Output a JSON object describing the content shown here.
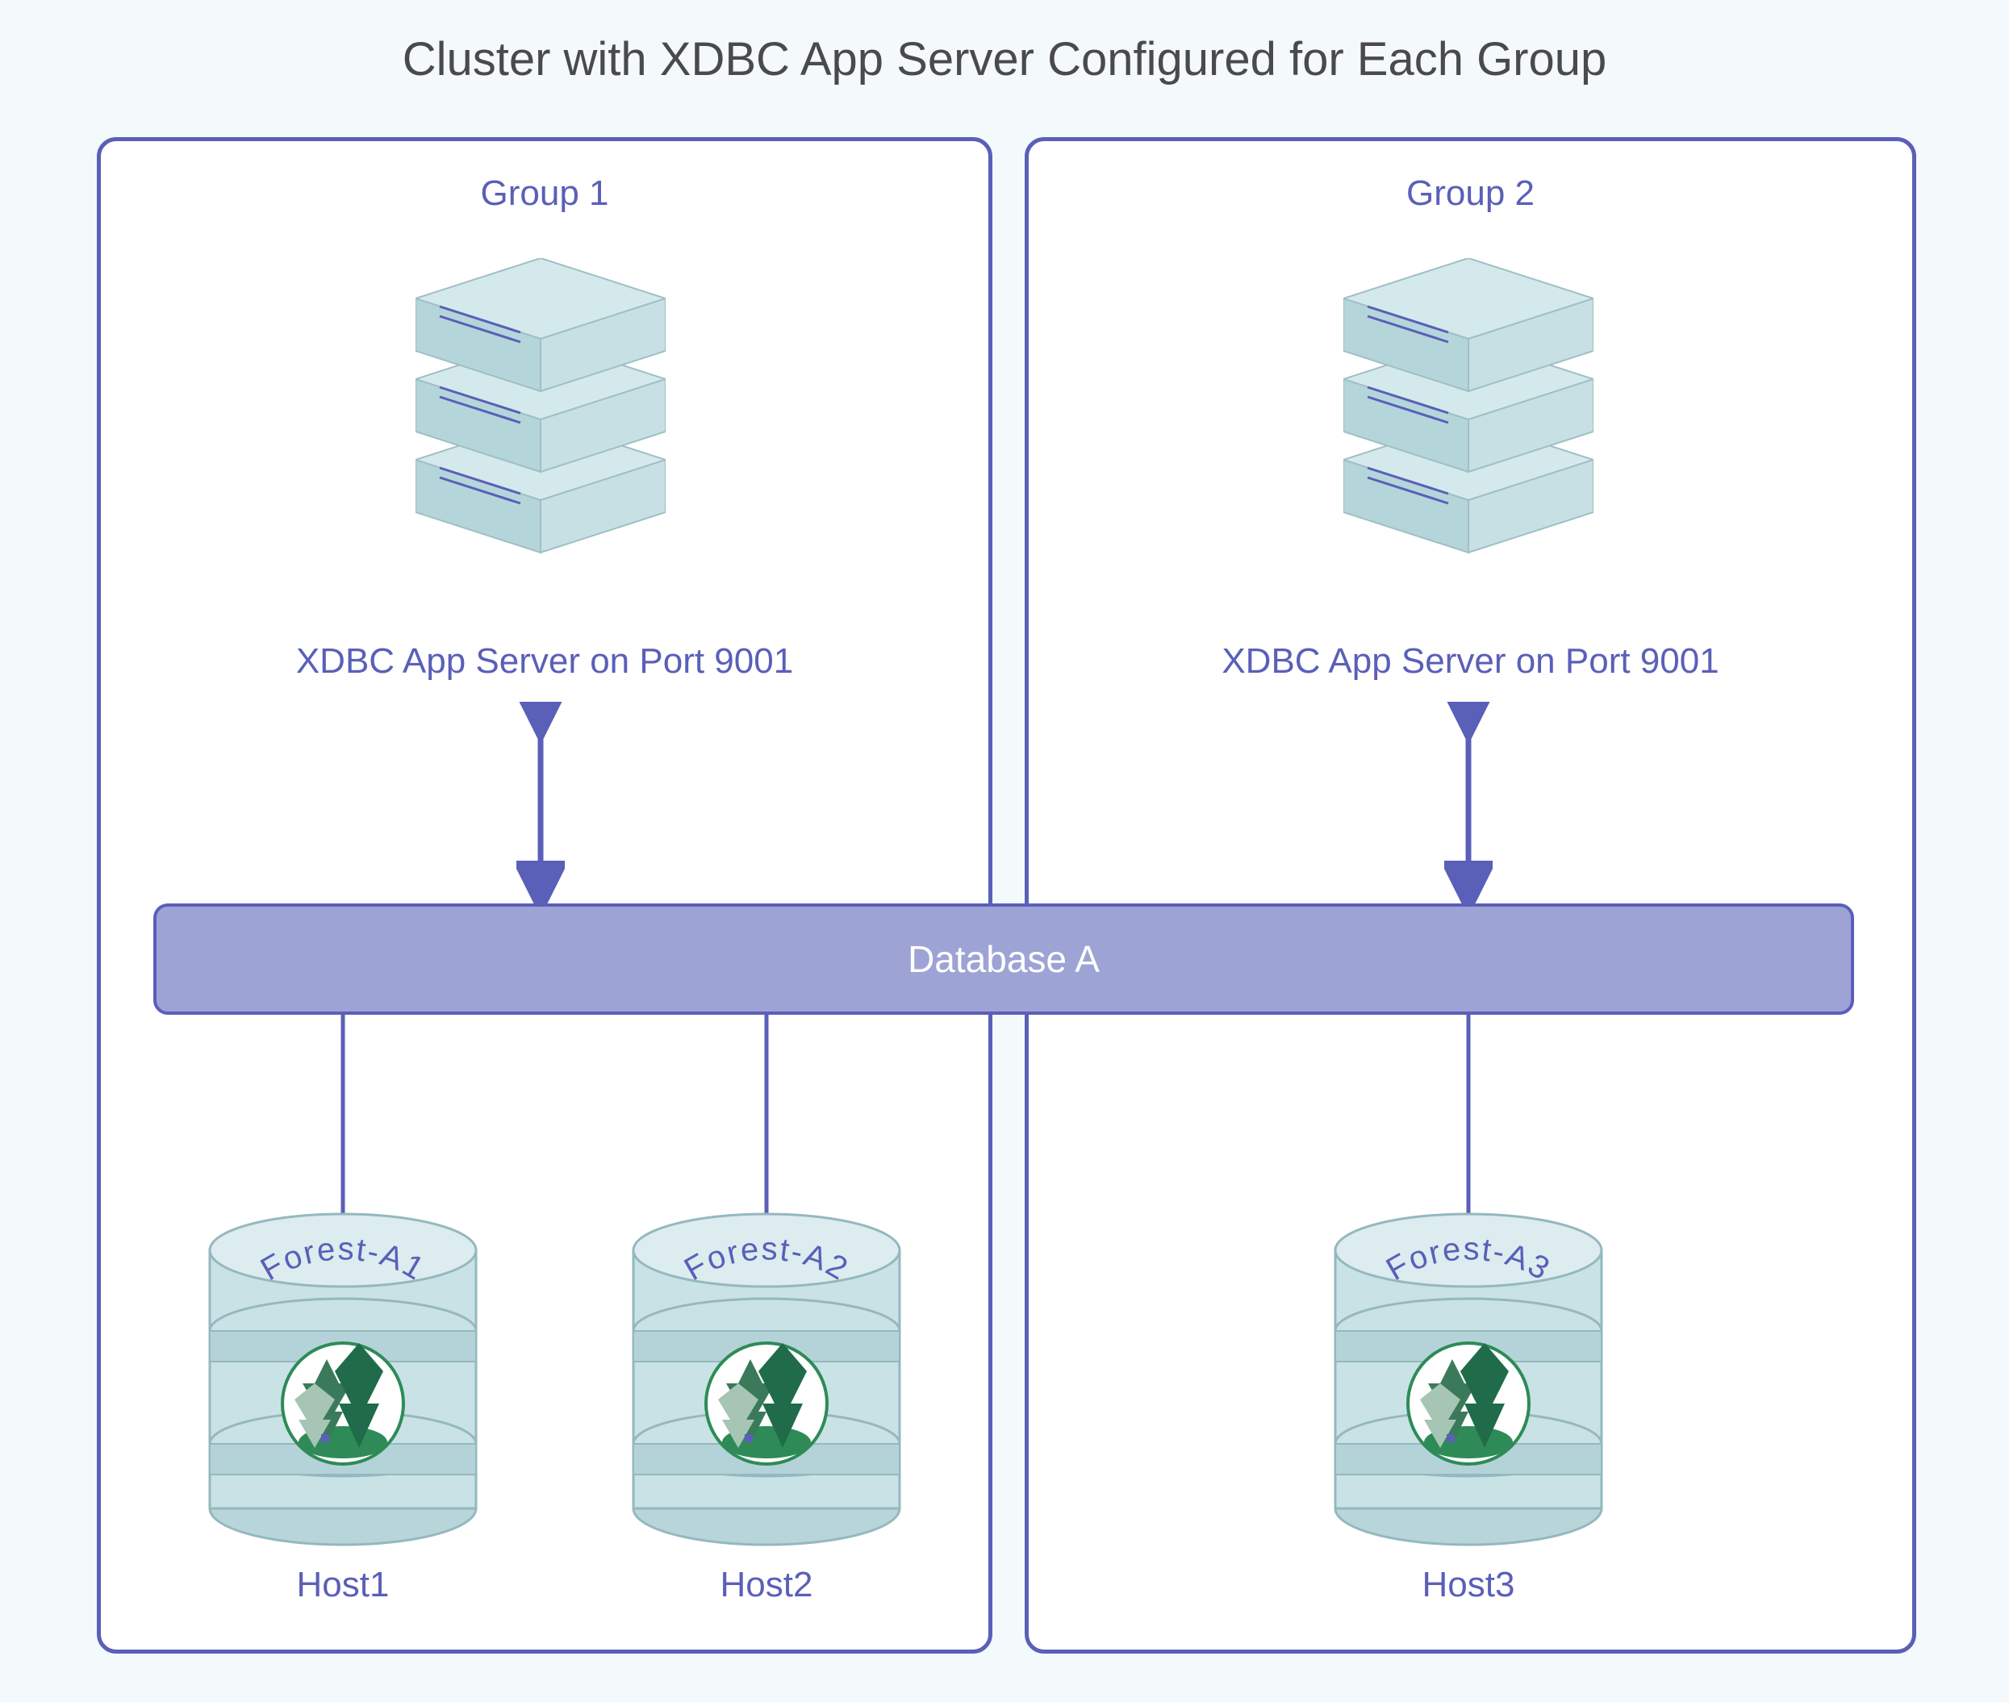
{
  "title": "Cluster with XDBC App Server Configured for Each Group",
  "groups": [
    {
      "label": "Group 1",
      "server_caption": "XDBC App Server on Port 9001"
    },
    {
      "label": "Group 2",
      "server_caption": "XDBC App Server on Port 9001"
    }
  ],
  "database": {
    "label": "Database A"
  },
  "forests": [
    {
      "name": "Forest-A1",
      "host": "Host1"
    },
    {
      "name": "Forest-A2",
      "host": "Host2"
    },
    {
      "name": "Forest-A3",
      "host": "Host3"
    }
  ],
  "chart_data": {
    "type": "diagram",
    "title": "Cluster with XDBC App Server Configured for Each Group",
    "nodes": [
      {
        "id": "group1",
        "type": "group",
        "label": "Group 1"
      },
      {
        "id": "group2",
        "type": "group",
        "label": "Group 2"
      },
      {
        "id": "server1",
        "type": "app-server",
        "label": "XDBC App Server on Port 9001",
        "group": "group1"
      },
      {
        "id": "server2",
        "type": "app-server",
        "label": "XDBC App Server on Port 9001",
        "group": "group2"
      },
      {
        "id": "dbA",
        "type": "database",
        "label": "Database A"
      },
      {
        "id": "forestA1",
        "type": "forest",
        "label": "Forest-A1",
        "host": "Host1",
        "group": "group1"
      },
      {
        "id": "forestA2",
        "type": "forest",
        "label": "Forest-A2",
        "host": "Host2",
        "group": "group1"
      },
      {
        "id": "forestA3",
        "type": "forest",
        "label": "Forest-A3",
        "host": "Host3",
        "group": "group2"
      }
    ],
    "edges": [
      {
        "from": "server1",
        "to": "dbA",
        "bidirectional": true
      },
      {
        "from": "server2",
        "to": "dbA",
        "bidirectional": true
      },
      {
        "from": "dbA",
        "to": "forestA1"
      },
      {
        "from": "dbA",
        "to": "forestA2"
      },
      {
        "from": "dbA",
        "to": "forestA3"
      }
    ]
  }
}
